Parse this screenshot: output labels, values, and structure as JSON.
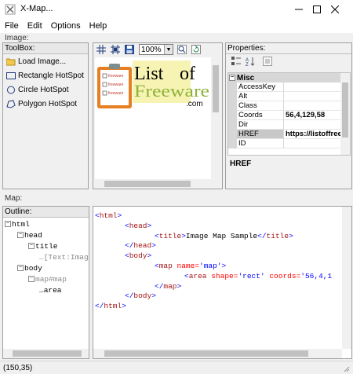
{
  "window": {
    "title": "X-Map..."
  },
  "menu": [
    "File",
    "Edit",
    "Options",
    "Help"
  ],
  "image_group": {
    "label": "Image:"
  },
  "toolbox": {
    "title": "ToolBox:",
    "items": [
      "Load Image...",
      "Rectangle HotSpot",
      "Circle HotSpot",
      "Polygon HotSpot"
    ]
  },
  "image_toolbar": {
    "zoom": "100%"
  },
  "canvas_image": {
    "logo_word1": "List",
    "logo_word2": "of",
    "logo_word3": "Freeware",
    "logo_suffix": ".com",
    "doc_lines": [
      "freeware",
      "freeware",
      "freeware"
    ]
  },
  "properties": {
    "title": "Properties:",
    "category": "Misc",
    "rows": [
      {
        "name": "AccessKey",
        "value": ""
      },
      {
        "name": "Alt",
        "value": ""
      },
      {
        "name": "Class",
        "value": ""
      },
      {
        "name": "Coords",
        "value": "56,4,129,58"
      },
      {
        "name": "Dir",
        "value": ""
      },
      {
        "name": "HREF",
        "value": "https://listoffree"
      },
      {
        "name": "ID",
        "value": ""
      }
    ],
    "description": "HREF"
  },
  "map_group": {
    "label": "Map:"
  },
  "outline": {
    "title": "Outline:",
    "nodes": [
      "html",
      "head",
      "title",
      "[Text:Imag",
      "body",
      "map#map",
      "area"
    ]
  },
  "code": {
    "lines": [
      [
        "<",
        "html",
        ">"
      ],
      [
        "<",
        "head",
        ">"
      ],
      [
        "<",
        "title",
        ">",
        "Image Map Sample",
        "</",
        "title",
        ">"
      ],
      [
        "</",
        "head",
        ">"
      ],
      [
        "<",
        "body",
        ">"
      ],
      [
        "<",
        "map",
        " name=",
        "'map'",
        ">"
      ],
      [
        "<",
        "area",
        " shape=",
        "'rect'",
        " coords=",
        "'56,4,1"
      ],
      [
        "</",
        "map",
        ">"
      ],
      [
        "</",
        "body",
        ">"
      ],
      [
        "</",
        "html",
        ">"
      ]
    ]
  },
  "status": {
    "text": "(150,35)"
  },
  "colors": {
    "tag": "#a31515",
    "bracket": "#0000ff",
    "attr": "#ff0000",
    "logo_red": "#c0392b",
    "logo_green": "#8db33a"
  }
}
